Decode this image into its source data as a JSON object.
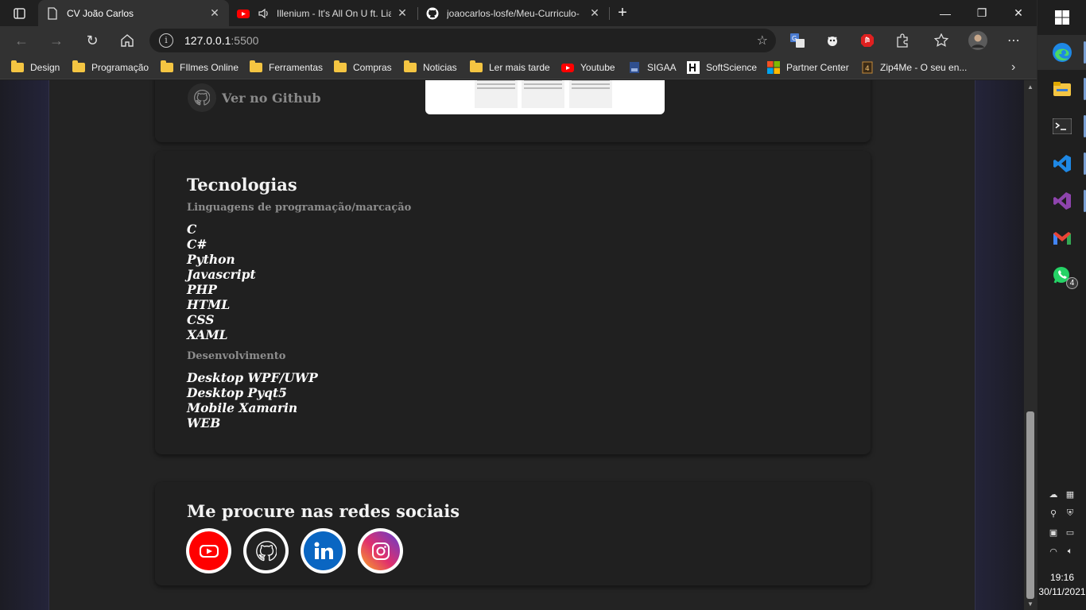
{
  "browser": {
    "tabs": [
      {
        "title": "CV João Carlos",
        "icon": "page-icon",
        "active": true
      },
      {
        "title": "Illenium - It's All On U ft. Lia",
        "icon": "youtube-icon",
        "active": false
      },
      {
        "title": "joaocarlos-losfe/Meu-Curriculo-",
        "icon": "github-icon",
        "active": false
      }
    ],
    "new_tab": "+",
    "window_controls": {
      "minimize": "—",
      "restore": "❐",
      "close": "✕"
    },
    "address": {
      "host": "127.0.0.1",
      "port": ":5500"
    },
    "bookmarks": [
      {
        "label": "Design",
        "icon": "folder-icon"
      },
      {
        "label": "Programação",
        "icon": "folder-icon"
      },
      {
        "label": "FIlmes Online",
        "icon": "folder-icon"
      },
      {
        "label": "Ferramentas",
        "icon": "folder-icon"
      },
      {
        "label": "Compras",
        "icon": "folder-icon"
      },
      {
        "label": "Noticias",
        "icon": "folder-icon"
      },
      {
        "label": "Ler mais tarde",
        "icon": "folder-icon"
      },
      {
        "label": "Youtube",
        "icon": "youtube-icon"
      },
      {
        "label": "SIGAA",
        "icon": "sigaa-icon"
      },
      {
        "label": "SoftScience",
        "icon": "softscience-icon"
      },
      {
        "label": "Partner Center",
        "icon": "microsoft-icon"
      },
      {
        "label": "Zip4Me - O seu en...",
        "icon": "zip4me-icon"
      }
    ]
  },
  "page": {
    "project": {
      "github_link": "Ver no Github"
    },
    "technologies": {
      "title": "Tecnologias",
      "languages_heading": "Linguagens de programação/marcação",
      "languages": [
        "C",
        "C#",
        "Python",
        "Javascript",
        "PHP",
        "HTML",
        "CSS",
        "XAML"
      ],
      "development_heading": "Desenvolvimento",
      "development": [
        "Desktop WPF/UWP",
        "Desktop Pyqt5",
        "Mobile Xamarin",
        "WEB"
      ]
    },
    "social": {
      "title": "Me procure nas redes sociais",
      "links": [
        {
          "name": "youtube",
          "color": "#ff0000"
        },
        {
          "name": "github",
          "color": "#222222"
        },
        {
          "name": "linkedin",
          "color": "#0a66c2"
        },
        {
          "name": "instagram",
          "color": "#c13584"
        }
      ]
    }
  },
  "taskbar": {
    "apps": [
      "edge-icon",
      "file-explorer-icon",
      "terminal-icon",
      "vscode-icon",
      "visual-studio-icon",
      "gmail-icon",
      "whatsapp-icon"
    ],
    "whatsapp_badge": "4",
    "time": "19:16",
    "date": "30/11/2021"
  }
}
